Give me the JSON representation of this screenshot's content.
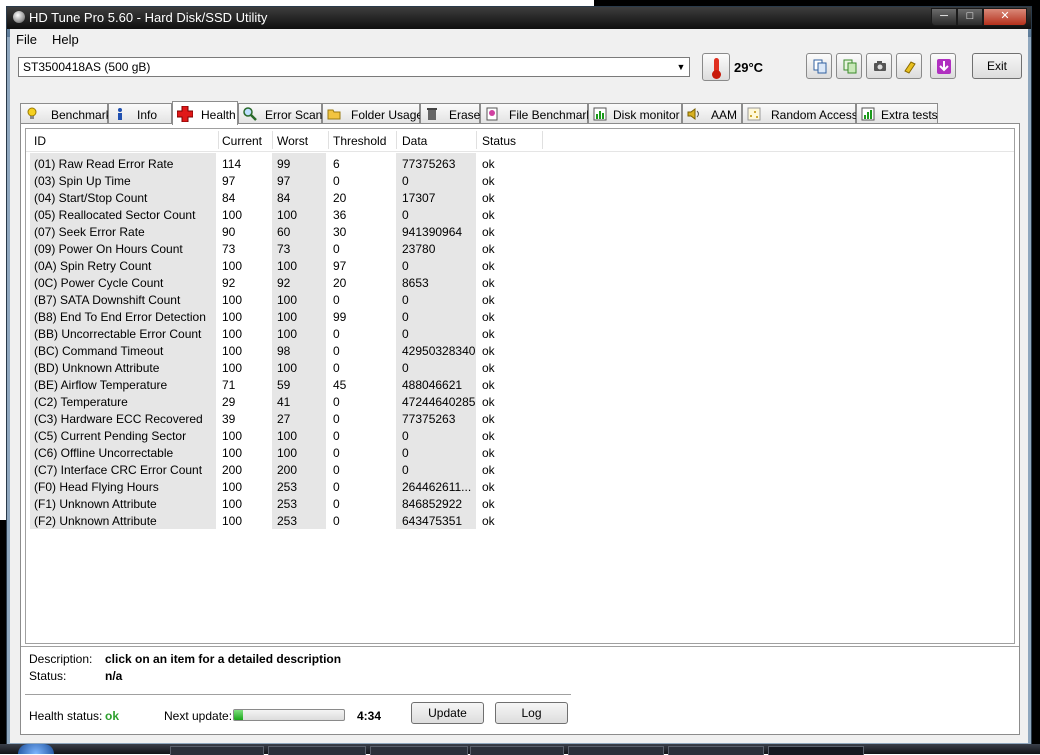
{
  "window": {
    "title": "HD Tune Pro 5.60 - Hard Disk/SSD Utility"
  },
  "menu": {
    "file": "File",
    "help": "Help"
  },
  "drive": {
    "selected": "ST3500418AS (500 gB)"
  },
  "temperature": "29°C",
  "toolbar": {
    "icons": [
      "copy-text-icon",
      "copy-info-icon",
      "camera-icon",
      "options-icon",
      "save-download-icon"
    ],
    "exit_label": "Exit"
  },
  "tabs": [
    {
      "label": "Benchmark",
      "icon": "lightbulb-icon"
    },
    {
      "label": "Info",
      "icon": "info-icon"
    },
    {
      "label": "Health",
      "icon": "red-cross-icon",
      "active": true
    },
    {
      "label": "Error Scan",
      "icon": "magnifier-icon"
    },
    {
      "label": "Folder Usage",
      "icon": "folder-icon"
    },
    {
      "label": "Erase",
      "icon": "trash-icon"
    },
    {
      "label": "File Benchmark",
      "icon": "file-benchmark-icon"
    },
    {
      "label": "Disk monitor",
      "icon": "disk-monitor-icon"
    },
    {
      "label": "AAM",
      "icon": "speaker-icon"
    },
    {
      "label": "Random Access",
      "icon": "random-access-icon"
    },
    {
      "label": "Extra tests",
      "icon": "extra-tests-icon"
    }
  ],
  "smart": {
    "columns": {
      "id": "ID",
      "current": "Current",
      "worst": "Worst",
      "threshold": "Threshold",
      "data": "Data",
      "status": "Status"
    },
    "rows": [
      {
        "id": "(01) Raw Read Error Rate",
        "current": "114",
        "worst": "99",
        "threshold": "6",
        "data": "77375263",
        "status": "ok"
      },
      {
        "id": "(03) Spin Up Time",
        "current": "97",
        "worst": "97",
        "threshold": "0",
        "data": "0",
        "status": "ok"
      },
      {
        "id": "(04) Start/Stop Count",
        "current": "84",
        "worst": "84",
        "threshold": "20",
        "data": "17307",
        "status": "ok"
      },
      {
        "id": "(05) Reallocated Sector Count",
        "current": "100",
        "worst": "100",
        "threshold": "36",
        "data": "0",
        "status": "ok"
      },
      {
        "id": "(07) Seek Error Rate",
        "current": "90",
        "worst": "60",
        "threshold": "30",
        "data": "941390964",
        "status": "ok"
      },
      {
        "id": "(09) Power On Hours Count",
        "current": "73",
        "worst": "73",
        "threshold": "0",
        "data": "23780",
        "status": "ok"
      },
      {
        "id": "(0A) Spin Retry Count",
        "current": "100",
        "worst": "100",
        "threshold": "97",
        "data": "0",
        "status": "ok"
      },
      {
        "id": "(0C) Power Cycle Count",
        "current": "92",
        "worst": "92",
        "threshold": "20",
        "data": "8653",
        "status": "ok"
      },
      {
        "id": "(B7) SATA Downshift Count",
        "current": "100",
        "worst": "100",
        "threshold": "0",
        "data": "0",
        "status": "ok"
      },
      {
        "id": "(B8) End To End Error Detection",
        "current": "100",
        "worst": "100",
        "threshold": "99",
        "data": "0",
        "status": "ok"
      },
      {
        "id": "(BB) Uncorrectable Error Count",
        "current": "100",
        "worst": "100",
        "threshold": "0",
        "data": "0",
        "status": "ok"
      },
      {
        "id": "(BC) Command Timeout",
        "current": "100",
        "worst": "98",
        "threshold": "0",
        "data": "42950328340",
        "status": "ok"
      },
      {
        "id": "(BD) Unknown Attribute",
        "current": "100",
        "worst": "100",
        "threshold": "0",
        "data": "0",
        "status": "ok"
      },
      {
        "id": "(BE) Airflow Temperature",
        "current": "71",
        "worst": "59",
        "threshold": "45",
        "data": "488046621",
        "status": "ok"
      },
      {
        "id": "(C2) Temperature",
        "current": "29",
        "worst": "41",
        "threshold": "0",
        "data": "47244640285",
        "status": "ok"
      },
      {
        "id": "(C3) Hardware ECC Recovered",
        "current": "39",
        "worst": "27",
        "threshold": "0",
        "data": "77375263",
        "status": "ok"
      },
      {
        "id": "(C5) Current Pending Sector",
        "current": "100",
        "worst": "100",
        "threshold": "0",
        "data": "0",
        "status": "ok"
      },
      {
        "id": "(C6) Offline Uncorrectable",
        "current": "100",
        "worst": "100",
        "threshold": "0",
        "data": "0",
        "status": "ok"
      },
      {
        "id": "(C7) Interface CRC Error Count",
        "current": "200",
        "worst": "200",
        "threshold": "0",
        "data": "0",
        "status": "ok"
      },
      {
        "id": "(F0) Head Flying Hours",
        "current": "100",
        "worst": "253",
        "threshold": "0",
        "data": "264462611...",
        "status": "ok"
      },
      {
        "id": "(F1) Unknown Attribute",
        "current": "100",
        "worst": "253",
        "threshold": "0",
        "data": "846852922",
        "status": "ok"
      },
      {
        "id": "(F2) Unknown Attribute",
        "current": "100",
        "worst": "253",
        "threshold": "0",
        "data": "643475351",
        "status": "ok"
      }
    ]
  },
  "details": {
    "description_label": "Description:",
    "description_value": "click on an item for a detailed description",
    "status_label": "Status:",
    "status_value": "n/a"
  },
  "footer": {
    "health_label": "Health status:",
    "health_value": "ok",
    "next_update_label": "Next update:",
    "progress_fraction": 0.08,
    "countdown": "4:34",
    "update_label": "Update",
    "log_label": "Log"
  },
  "colors": {
    "health_ok": "#2da02d",
    "titlebar": "#1a1a1a",
    "progress": "#1aa51a"
  }
}
